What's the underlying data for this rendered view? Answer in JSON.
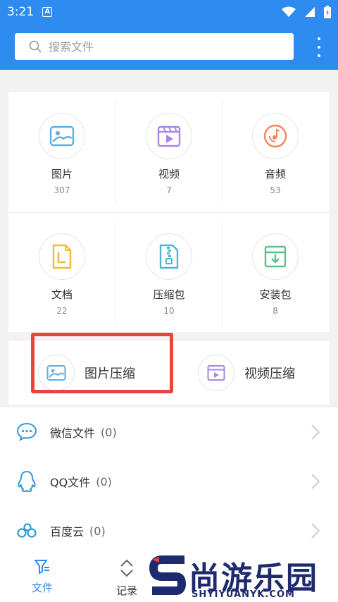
{
  "status_bar": {
    "time": "3:21",
    "notification_badge": "A"
  },
  "search": {
    "placeholder": "搜索文件",
    "value": ""
  },
  "categories": [
    {
      "label": "图片",
      "count": "307",
      "icon": "image-icon",
      "color": "#5aaee8"
    },
    {
      "label": "视频",
      "count": "7",
      "icon": "video-icon",
      "color": "#a886e6"
    },
    {
      "label": "音频",
      "count": "53",
      "icon": "music-disc-icon",
      "color": "#f0865a"
    },
    {
      "label": "文档",
      "count": "22",
      "icon": "document-icon",
      "color": "#f5b83c"
    },
    {
      "label": "压缩包",
      "count": "10",
      "icon": "zip-icon",
      "color": "#4fb6cf"
    },
    {
      "label": "安装包",
      "count": "8",
      "icon": "install-box-icon",
      "color": "#5cc08a"
    }
  ],
  "compress": {
    "image_label": "图片压缩",
    "video_label": "视频压缩"
  },
  "sources": [
    {
      "label": "微信文件",
      "count": "(0)",
      "icon": "wechat-icon"
    },
    {
      "label": "QQ文件",
      "count": "(0)",
      "icon": "qq-icon"
    },
    {
      "label": "百度云",
      "count": "(0)",
      "icon": "baidu-cloud-icon"
    }
  ],
  "nav": {
    "files_label": "文件",
    "records_label": "记录"
  },
  "watermark": {
    "title": "尚游乐园",
    "url": "SHYIYUANYK.COM"
  },
  "colors": {
    "primary": "#2e8bf0",
    "highlight": "#e8453c"
  }
}
